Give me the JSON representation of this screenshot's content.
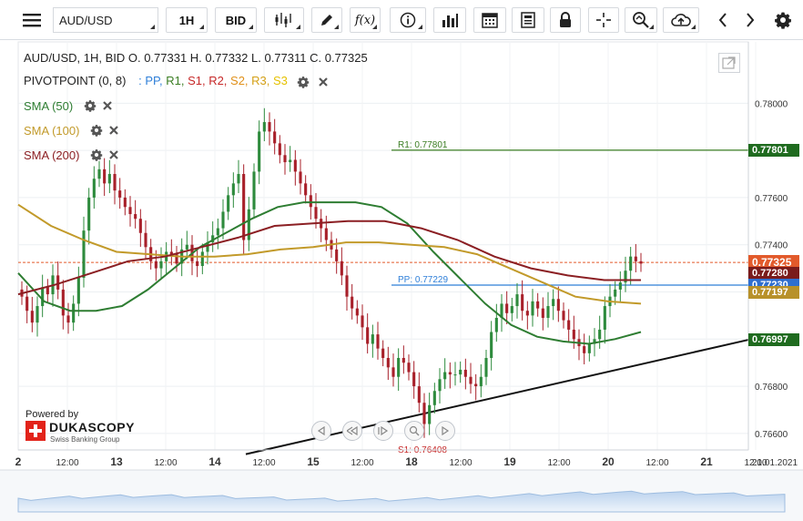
{
  "toolbar": {
    "symbol": "AUD/USD",
    "timeframe": "1H",
    "side": "BID",
    "fx_label": "f(x)"
  },
  "legend": {
    "ohlc": "AUD/USD, 1H, BID    O. 0.77331 H. 0.77332 L. 0.77311 C. 0.77325",
    "pivot_name": "PIVOTPOINT (0, 8)",
    "pivot_items": [
      {
        "label": "PP,",
        "color": "#2f7fd8"
      },
      {
        "label": "R1,",
        "color": "#3a7d22"
      },
      {
        "label": "S1,",
        "color": "#c62828"
      },
      {
        "label": "R2,",
        "color": "#c62828"
      },
      {
        "label": "S2,",
        "color": "#e0901a"
      },
      {
        "label": "R3,",
        "color": "#d4a017"
      },
      {
        "label": "S3",
        "color": "#e5c100"
      }
    ],
    "sma": [
      {
        "label": "SMA (50)",
        "color": "#2e7d32"
      },
      {
        "label": "SMA (100)",
        "color": "#c29a2a"
      },
      {
        "label": "SMA (200)",
        "color": "#8b1f23"
      }
    ]
  },
  "branding": {
    "powered": "Powered by",
    "name": "DUKASCOPY",
    "tagline": "Swiss Banking Group"
  },
  "chart_data": {
    "type": "candlestick",
    "symbol": "AUD/USD",
    "interval": "1H",
    "ylim": [
      0.7653,
      0.7826
    ],
    "y_ticks": [
      "0.78000",
      "0.77800",
      "0.77600",
      "0.77400",
      "0.77200",
      "0.77000",
      "0.76800",
      "0.76600"
    ],
    "x_ticks": [
      "2",
      "12:00",
      "13",
      "12:00",
      "14",
      "12:00",
      "15",
      "12:00",
      "18",
      "12:00",
      "19",
      "12:00",
      "20",
      "12:00",
      "21",
      "12:00",
      "21.01.2021"
    ],
    "close_series": [
      0.7718,
      0.7712,
      0.7707,
      0.7714,
      0.7722,
      0.7719,
      0.7727,
      0.7721,
      0.771,
      0.7707,
      0.7715,
      0.7726,
      0.7746,
      0.776,
      0.7768,
      0.7772,
      0.7766,
      0.777,
      0.7763,
      0.776,
      0.7756,
      0.7753,
      0.7751,
      0.7745,
      0.7739,
      0.7733,
      0.773,
      0.7733,
      0.7737,
      0.7736,
      0.7732,
      0.7738,
      0.774,
      0.7733,
      0.7731,
      0.7737,
      0.7741,
      0.7744,
      0.7747,
      0.7754,
      0.7761,
      0.7766,
      0.777,
      0.7742,
      0.7755,
      0.7771,
      0.7788,
      0.7792,
      0.7788,
      0.7783,
      0.7778,
      0.7775,
      0.7776,
      0.7771,
      0.7766,
      0.7761,
      0.7756,
      0.7751,
      0.7747,
      0.7742,
      0.7738,
      0.7733,
      0.7727,
      0.7718,
      0.7713,
      0.771,
      0.7705,
      0.7698,
      0.7702,
      0.7696,
      0.7692,
      0.7688,
      0.7684,
      0.7692,
      0.769,
      0.7686,
      0.768,
      0.7673,
      0.7664,
      0.7672,
      0.7678,
      0.7683,
      0.7686,
      0.7685,
      0.7685,
      0.7687,
      0.7684,
      0.7681,
      0.768,
      0.7684,
      0.7692,
      0.7703,
      0.7709,
      0.7715,
      0.7711,
      0.7714,
      0.7719,
      0.7712,
      0.771,
      0.7716,
      0.7713,
      0.7709,
      0.7714,
      0.7717,
      0.7712,
      0.7708,
      0.7704,
      0.77,
      0.7697,
      0.7694,
      0.7698,
      0.77,
      0.7704,
      0.7714,
      0.7718,
      0.7721,
      0.7724,
      0.7729,
      0.7735,
      0.7733,
      0.7732
    ],
    "series": [
      {
        "name": "SMA (50)",
        "color": "#2e7d32",
        "values": [
          0.7728,
          0.7716,
          0.7712,
          0.7712,
          0.7714,
          0.7721,
          0.773,
          0.7739,
          0.7745,
          0.7751,
          0.7756,
          0.7758,
          0.7758,
          0.7758,
          0.7756,
          0.7749,
          0.7737,
          0.7726,
          0.7715,
          0.7706,
          0.7701,
          0.7699,
          0.7698,
          0.77,
          0.7703
        ]
      },
      {
        "name": "SMA (100)",
        "color": "#c29a2a",
        "values": [
          0.7757,
          0.7748,
          0.7742,
          0.7737,
          0.7736,
          0.7735,
          0.7735,
          0.7736,
          0.7738,
          0.7739,
          0.7741,
          0.7741,
          0.774,
          0.7739,
          0.7736,
          0.773,
          0.7724,
          0.7718,
          0.7716,
          0.7715
        ]
      },
      {
        "name": "SMA (200)",
        "color": "#8b1f23",
        "values": [
          0.7719,
          0.7723,
          0.7728,
          0.7733,
          0.7735,
          0.7739,
          0.7743,
          0.7748,
          0.7749,
          0.775,
          0.775,
          0.7747,
          0.7742,
          0.7735,
          0.773,
          0.7727,
          0.7725,
          0.7725
        ]
      }
    ],
    "pivot_lines": [
      {
        "label": "R1: 0.77801",
        "value": 0.77801,
        "color": "#3a7d22"
      },
      {
        "label": "PP: 0.77229",
        "value": 0.77229,
        "color": "#2f7fd8"
      },
      {
        "label": "S1: 0.76408",
        "value": 0.76408,
        "color": "#c62828"
      }
    ],
    "trendline": {
      "from": 0.7652,
      "to": 0.76997,
      "color": "#111111"
    },
    "price_badges": [
      {
        "label": "0.77801",
        "value": 0.77801,
        "color": "#1f6b1f"
      },
      {
        "label": "0.77325",
        "value": 0.77325,
        "color": "#e25a2b"
      },
      {
        "label": "0.77280",
        "value": 0.7728,
        "color": "#7a1b1b"
      },
      {
        "label": "0.77230",
        "value": 0.7723,
        "color": "#2f6fd0"
      },
      {
        "label": "0.77197",
        "value": 0.77197,
        "color": "#b8912a"
      },
      {
        "label": "0.76997",
        "value": 0.76997,
        "color": "#1f6b1f"
      }
    ],
    "current_price": 0.77325
  }
}
